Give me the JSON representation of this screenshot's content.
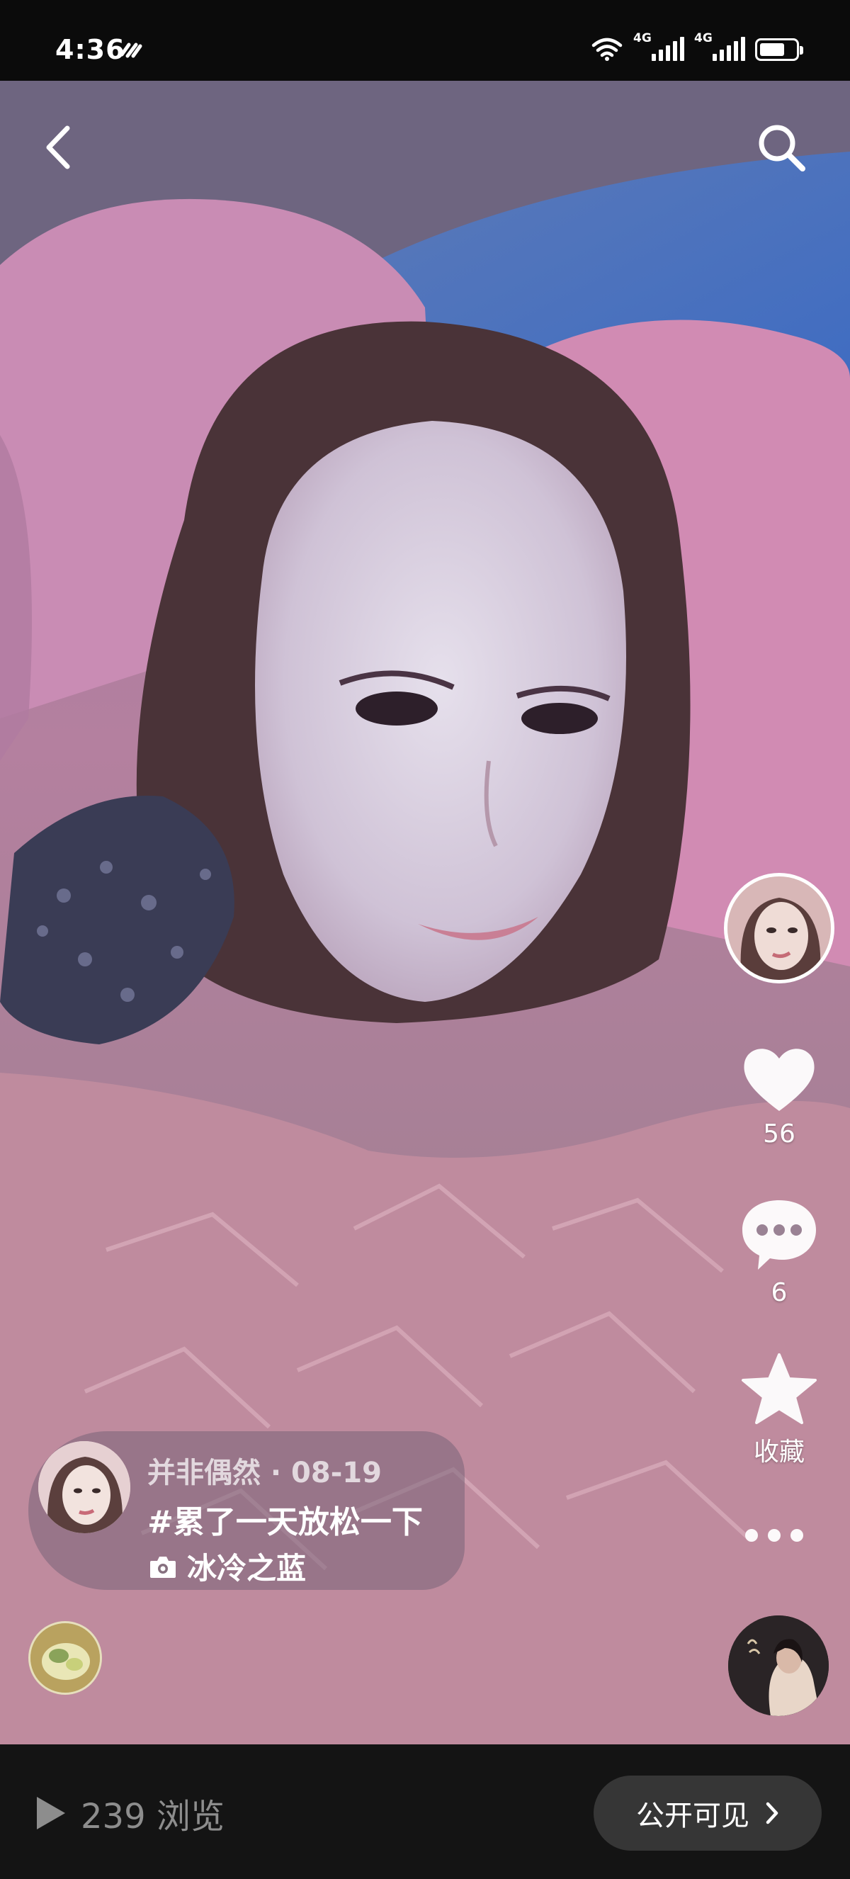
{
  "status_bar": {
    "time": "4:36",
    "network_1": "4G",
    "network_2": "4G",
    "battery_level": 0.7
  },
  "post": {
    "author": "并非偶然",
    "date": "08-19",
    "meta": "并非偶然 · 08-19",
    "title": "#累了一天放松一下",
    "location": "冰冷之蓝"
  },
  "actions": {
    "like_count": "56",
    "comment_count": "6",
    "favorite_label": "收藏"
  },
  "bottom": {
    "views": "239 浏览",
    "visibility_label": "公开可见"
  },
  "icons": [
    "back-arrow-icon",
    "search-icon",
    "heart-icon",
    "comment-icon",
    "star-icon",
    "more-icon",
    "camera-icon",
    "play-icon",
    "chevron-right-icon",
    "wifi-icon",
    "battery-icon"
  ],
  "colors": {
    "status_bar_bg": "#0b0b0b",
    "bottom_bar_bg": "#141414",
    "pill_bg": "#363636",
    "muted_text": "#8d8d8d"
  }
}
